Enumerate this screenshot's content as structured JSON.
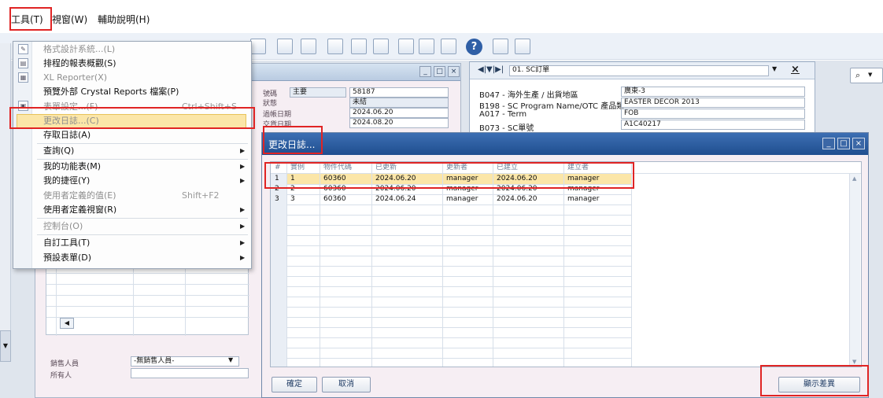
{
  "menubar": {
    "items": [
      "工具(T)",
      "視窗(W)",
      "輔助說明(H)"
    ]
  },
  "tools_menu": {
    "items": [
      {
        "label": "格式設計系統...(L)",
        "disabled": true
      },
      {
        "label": "排程的報表概觀(S)",
        "disabled": false
      },
      {
        "label": "XL Reporter(X)",
        "disabled": true
      },
      {
        "label": "預覽外部 Crystal Reports 檔案(P)",
        "disabled": false
      },
      {
        "label": "表單設定...(F)",
        "shortcut": "Ctrl+Shift+S",
        "disabled": true
      },
      {
        "label": "更改日誌...(C)",
        "disabled": true,
        "highlighted": true
      },
      {
        "label": "存取日誌(A)",
        "disabled": false
      },
      {
        "label": "查詢(Q)",
        "submenu": true
      },
      {
        "label": "我的功能表(M)",
        "submenu": true
      },
      {
        "label": "我的捷徑(Y)",
        "submenu": true
      },
      {
        "label": "使用者定義的值(E)",
        "shortcut": "Shift+F2",
        "disabled": true
      },
      {
        "label": "使用者定義視窗(R)",
        "submenu": true
      },
      {
        "label": "控制台(O)",
        "submenu": true,
        "disabled": true
      },
      {
        "label": "自訂工具(T)",
        "submenu": true
      },
      {
        "label": "預設表單(D)",
        "submenu": true
      }
    ]
  },
  "doc_form": {
    "fields": [
      {
        "label": "號碼",
        "tag": "主要",
        "value": "58187"
      },
      {
        "label": "狀態",
        "value": "未結"
      },
      {
        "label": "過帳日期",
        "value": "2024.06.20"
      },
      {
        "label": "交貨日期",
        "value": "2024.08.20"
      }
    ],
    "sales_label": "銷售人員",
    "sales_value": "-無銷售人員-",
    "owner_label": "所有人"
  },
  "udf_panel": {
    "title": "01. SC訂單",
    "rows": [
      {
        "label": "B047 - 海外生產 / 出貨地區",
        "value": "廣東-3"
      },
      {
        "label": "B198 - SC Program Name/OTC 產品類",
        "value": "EASTER DECOR 2013"
      },
      {
        "label": "A017 - Term",
        "value": "FOB"
      },
      {
        "label": "B073 - SC單號",
        "value": "A1C40217"
      }
    ]
  },
  "dialog": {
    "title": "更改日誌...",
    "columns": [
      "#",
      "實例",
      "物件代碼",
      "已更新",
      "更新者",
      "已建立",
      "建立者"
    ],
    "rows": [
      [
        "1",
        "1",
        "60360",
        "2024.06.20",
        "manager",
        "2024.06.20",
        "manager"
      ],
      [
        "2",
        "2",
        "60360",
        "2024.06.20",
        "manager",
        "2024.06.20",
        "manager"
      ],
      [
        "3",
        "3",
        "60360",
        "2024.06.24",
        "manager",
        "2024.06.20",
        "manager"
      ]
    ],
    "ok_label": "確定",
    "cancel_label": "取消",
    "show_diff_label": "顯示差異"
  },
  "colors": {
    "highlight_row": "#fbe6a8",
    "dialog_titlebar": "#2a5a9e",
    "annotation_red": "#e02424"
  }
}
